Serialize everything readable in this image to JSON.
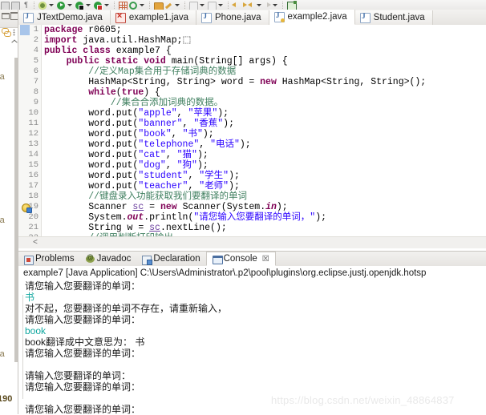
{
  "toolbar": {
    "items": [
      {
        "name": "perspective-icon",
        "glyph": "sq"
      },
      {
        "name": "paragraph-mark-icon",
        "glyph": "pilcrow"
      },
      {
        "name": "external-tools-icon",
        "glyph": "gear"
      },
      {
        "name": "run-icon",
        "glyph": "play"
      },
      {
        "name": "debug-icon",
        "glyph": "dbg"
      },
      {
        "name": "coverage-icon",
        "glyph": "dbg2"
      },
      {
        "name": "new-java-class-icon",
        "glyph": "grid"
      },
      {
        "name": "refresh-icon",
        "glyph": "circ"
      },
      {
        "name": "open-type-icon",
        "glyph": "folder"
      },
      {
        "name": "search-icon",
        "glyph": "pen"
      },
      {
        "name": "next-annotation-icon",
        "glyph": "dl"
      },
      {
        "name": "previous-annotation-icon",
        "glyph": "dl"
      },
      {
        "name": "back-icon",
        "glyph": "arr-l"
      },
      {
        "name": "forward-icon",
        "glyph": "arr-r"
      },
      {
        "name": "last-edit-icon",
        "glyph": "arr-l"
      },
      {
        "name": "next-edit-icon",
        "glyph": "arr-g"
      },
      {
        "name": "new-window-icon",
        "glyph": "newf"
      }
    ]
  },
  "left_strip": {
    "clipped_labels": [
      "ava",
      "ava",
      "ava"
    ],
    "clipped_number": "190"
  },
  "editor": {
    "tabs": [
      {
        "label": "JTextDemo.java",
        "state": "normal",
        "active": false
      },
      {
        "label": "example1.java",
        "state": "error",
        "active": false
      },
      {
        "label": "Phone.java",
        "state": "normal",
        "active": false
      },
      {
        "label": "example2.java",
        "state": "warning",
        "active": true
      },
      {
        "label": "Student.java",
        "state": "normal",
        "active": false
      }
    ],
    "scroll_marker": "<",
    "lines": [
      {
        "num": "1",
        "fold": "",
        "marker": "",
        "tokens": [
          {
            "t": "kw",
            "s": "package"
          },
          {
            "t": "plain",
            "s": " r0605;"
          }
        ]
      },
      {
        "num": "2",
        "fold": "⊕",
        "marker": "",
        "tokens": [
          {
            "t": "kw",
            "s": "import"
          },
          {
            "t": "plain",
            "s": " java.util.HashMap;⬚"
          }
        ]
      },
      {
        "num": "4",
        "fold": "",
        "marker": "",
        "tokens": [
          {
            "t": "kw",
            "s": "public class"
          },
          {
            "t": "plain",
            "s": " example7 {"
          }
        ]
      },
      {
        "num": "5",
        "fold": "⊖",
        "marker": "",
        "tokens": [
          {
            "t": "plain",
            "s": "    "
          },
          {
            "t": "kw",
            "s": "public static void"
          },
          {
            "t": "plain",
            "s": " main(String[] args) {"
          }
        ]
      },
      {
        "num": "6",
        "fold": "",
        "marker": "",
        "tokens": [
          {
            "t": "cmt",
            "s": "        //定义Map集合用于存储词典的数据"
          }
        ]
      },
      {
        "num": "7",
        "fold": "",
        "marker": "",
        "tokens": [
          {
            "t": "plain",
            "s": "        HashMap<String, String> word = "
          },
          {
            "t": "kw",
            "s": "new"
          },
          {
            "t": "plain",
            "s": " HashMap<String, String>();"
          }
        ]
      },
      {
        "num": "8",
        "fold": "",
        "marker": "",
        "tokens": [
          {
            "t": "plain",
            "s": "        "
          },
          {
            "t": "kw",
            "s": "while"
          },
          {
            "t": "plain",
            "s": "("
          },
          {
            "t": "kw",
            "s": "true"
          },
          {
            "t": "plain",
            "s": ") {"
          }
        ]
      },
      {
        "num": "9",
        "fold": "",
        "marker": "",
        "tokens": [
          {
            "t": "cmt",
            "s": "            //集合合添加词典的数据。"
          }
        ]
      },
      {
        "num": "10",
        "fold": "",
        "marker": "",
        "tokens": [
          {
            "t": "plain",
            "s": "        word.put("
          },
          {
            "t": "str",
            "s": "\"apple\""
          },
          {
            "t": "plain",
            "s": ", "
          },
          {
            "t": "str",
            "s": "\"苹果\""
          },
          {
            "t": "plain",
            "s": ");"
          }
        ]
      },
      {
        "num": "11",
        "fold": "",
        "marker": "",
        "tokens": [
          {
            "t": "plain",
            "s": "        word.put("
          },
          {
            "t": "str",
            "s": "\"banner\""
          },
          {
            "t": "plain",
            "s": ", "
          },
          {
            "t": "str",
            "s": "\"香蕉\""
          },
          {
            "t": "plain",
            "s": ");"
          }
        ]
      },
      {
        "num": "12",
        "fold": "",
        "marker": "",
        "tokens": [
          {
            "t": "plain",
            "s": "        word.put("
          },
          {
            "t": "str",
            "s": "\"book\""
          },
          {
            "t": "plain",
            "s": ", "
          },
          {
            "t": "str",
            "s": "\"书\""
          },
          {
            "t": "plain",
            "s": ");"
          }
        ]
      },
      {
        "num": "13",
        "fold": "",
        "marker": "",
        "tokens": [
          {
            "t": "plain",
            "s": "        word.put("
          },
          {
            "t": "str",
            "s": "\"telephone\""
          },
          {
            "t": "plain",
            "s": ", "
          },
          {
            "t": "str",
            "s": "\"电话\""
          },
          {
            "t": "plain",
            "s": ");"
          }
        ]
      },
      {
        "num": "14",
        "fold": "",
        "marker": "",
        "tokens": [
          {
            "t": "plain",
            "s": "        word.put("
          },
          {
            "t": "str",
            "s": "\"cat\""
          },
          {
            "t": "plain",
            "s": ", "
          },
          {
            "t": "str",
            "s": "\"猫\""
          },
          {
            "t": "plain",
            "s": ");"
          }
        ]
      },
      {
        "num": "15",
        "fold": "",
        "marker": "",
        "tokens": [
          {
            "t": "plain",
            "s": "        word.put("
          },
          {
            "t": "str",
            "s": "\"dog\""
          },
          {
            "t": "plain",
            "s": ", "
          },
          {
            "t": "str",
            "s": "\"狗\""
          },
          {
            "t": "plain",
            "s": ");"
          }
        ]
      },
      {
        "num": "16",
        "fold": "",
        "marker": "",
        "tokens": [
          {
            "t": "plain",
            "s": "        word.put("
          },
          {
            "t": "str",
            "s": "\"student\""
          },
          {
            "t": "plain",
            "s": ", "
          },
          {
            "t": "str",
            "s": "\"学生\""
          },
          {
            "t": "plain",
            "s": ");"
          }
        ]
      },
      {
        "num": "17",
        "fold": "",
        "marker": "",
        "tokens": [
          {
            "t": "plain",
            "s": "        word.put("
          },
          {
            "t": "str",
            "s": "\"teacher\""
          },
          {
            "t": "plain",
            "s": ", "
          },
          {
            "t": "str",
            "s": "\"老师\""
          },
          {
            "t": "plain",
            "s": ");"
          }
        ]
      },
      {
        "num": "18",
        "fold": "",
        "marker": "",
        "tokens": [
          {
            "t": "cmt",
            "s": "        //键盘录入功能获取我们要翻译的单词"
          }
        ]
      },
      {
        "num": "19",
        "fold": "",
        "marker": "bulb",
        "tokens": [
          {
            "t": "plain",
            "s": "        Scanner "
          },
          {
            "t": "lvar",
            "s": "sc"
          },
          {
            "t": "plain",
            "s": " = "
          },
          {
            "t": "kw",
            "s": "new"
          },
          {
            "t": "plain",
            "s": " Scanner(System."
          },
          {
            "t": "kw2",
            "s": "in"
          },
          {
            "t": "plain",
            "s": ");"
          }
        ]
      },
      {
        "num": "20",
        "fold": "",
        "marker": "",
        "tokens": [
          {
            "t": "plain",
            "s": "        System."
          },
          {
            "t": "kw2",
            "s": "out"
          },
          {
            "t": "plain",
            "s": ".println("
          },
          {
            "t": "str",
            "s": "\"请您输入您要翻译的单词，\""
          },
          {
            "t": "plain",
            "s": ");"
          }
        ]
      },
      {
        "num": "21",
        "fold": "",
        "marker": "",
        "tokens": [
          {
            "t": "plain",
            "s": "        String w = "
          },
          {
            "t": "lvar",
            "s": "sc"
          },
          {
            "t": "plain",
            "s": ".nextLine();"
          }
        ]
      },
      {
        "num": "22",
        "fold": "",
        "marker": "",
        "tokens": [
          {
            "t": "cmt",
            "s": "        //调用判断打印输出"
          }
        ]
      }
    ]
  },
  "bottom_panel": {
    "tabs": [
      {
        "label": "Problems",
        "icon": "problems-icon",
        "active": false
      },
      {
        "label": "Javadoc",
        "icon": "javadoc-icon",
        "active": false
      },
      {
        "label": "Declaration",
        "icon": "declaration-icon",
        "active": false
      },
      {
        "label": "Console",
        "icon": "console-icon",
        "active": true
      }
    ],
    "close_glyph": "☒",
    "console": {
      "header": "example7 [Java Application] C:\\Users\\Administrator\\.p2\\pool\\plugins\\org.eclipse.justj.openjdk.hotsp",
      "lines": [
        {
          "text": "请您输入您要翻译的单词：",
          "kind": "out"
        },
        {
          "text": "书",
          "kind": "in"
        },
        {
          "text": "对不起，您要翻译的单词不存在，请重新输入，",
          "kind": "out"
        },
        {
          "text": "请您输入您要翻译的单词：",
          "kind": "out"
        },
        {
          "text": "book",
          "kind": "in"
        },
        {
          "text": "book翻译成中文意思为： 书",
          "kind": "out"
        },
        {
          "text": "请您输入您要翻译的单词：",
          "kind": "out"
        },
        {
          "text": "",
          "kind": "out"
        },
        {
          "text": "请输入您要翻译的单词：",
          "kind": "out"
        },
        {
          "text": "请您输入您要翻译的单词：",
          "kind": "out"
        },
        {
          "text": "",
          "kind": "out"
        },
        {
          "text": "请您输入您要翻译的单词：",
          "kind": "out"
        }
      ]
    }
  },
  "watermark": "https://blog.csdn.net/weixin_48864837",
  "colors": {
    "keyword": "#7f0055",
    "string": "#2a00ff",
    "comment": "#3f7f5f",
    "console_input": "#12a8a0",
    "tab_active_bg": "#ffffff"
  }
}
